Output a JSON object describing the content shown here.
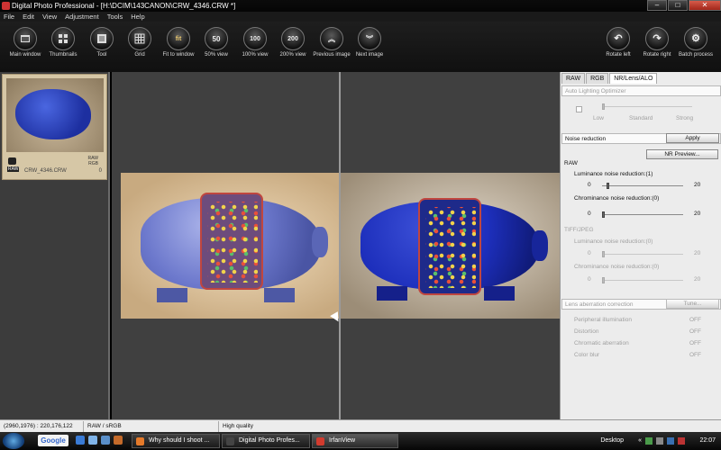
{
  "window": {
    "title": "Digital Photo Professional - [H:\\DCIM\\143CANON\\CRW_4346.CRW *]",
    "minimize_label": "–",
    "maximize_label": "□",
    "close_label": "✕"
  },
  "menu": [
    "File",
    "Edit",
    "View",
    "Adjustment",
    "Tools",
    "Help"
  ],
  "toolbar": {
    "buttons": [
      {
        "label": "Main window",
        "glyph": ""
      },
      {
        "label": "Thumbnails",
        "glyph": ""
      },
      {
        "label": "Tool",
        "glyph": ""
      },
      {
        "label": "Grid",
        "glyph": ""
      },
      {
        "label": "Fit to window",
        "glyph": "fit"
      },
      {
        "label": "50% view",
        "glyph": "50"
      },
      {
        "label": "100% view",
        "glyph": "100"
      },
      {
        "label": "200% view",
        "glyph": "200"
      },
      {
        "label": "Previous image",
        "glyph": "︽"
      },
      {
        "label": "Next image",
        "glyph": "︾"
      }
    ],
    "right_buttons": [
      {
        "label": "Rotate left",
        "glyph": "↶"
      },
      {
        "label": "Rotate right",
        "glyph": "↷"
      },
      {
        "label": "Batch process",
        "glyph": "⚙"
      }
    ]
  },
  "thumbnail": {
    "filename": "CRW_4346.CRW",
    "tags": [
      "RAW",
      "RGB"
    ],
    "raw_badge": "RAW",
    "index": "0"
  },
  "palette": {
    "tabs": [
      "RAW",
      "RGB",
      "NR/Lens/ALO"
    ],
    "active_tab": "NR/Lens/ALO",
    "alo": {
      "title": "Auto Lighting Optimizer",
      "levels": [
        "Low",
        "Standard",
        "Strong"
      ],
      "enabled": false
    },
    "nr": {
      "title": "Noise reduction",
      "apply_label": "Apply",
      "preview_label": "NR Preview...",
      "raw_heading": "RAW",
      "raw_luminance_label": "Luminance noise reduction:(1)",
      "raw_luminance_value": 1,
      "raw_chrominance_label": "Chrominance noise reduction:(0)",
      "raw_chrominance_value": 0,
      "slider_min": "0",
      "slider_max": "20",
      "tiff_heading": "TIFF/JPEG",
      "tiff_luminance_label": "Luminance noise reduction:(0)",
      "tiff_chrominance_label": "Chrominance noise reduction:(0)"
    },
    "lens": {
      "title": "Lens aberration correction",
      "tune_label": "Tune...",
      "items": [
        {
          "label": "Peripheral illumination",
          "value": "OFF"
        },
        {
          "label": "Distortion",
          "value": "OFF"
        },
        {
          "label": "Chromatic aberration",
          "value": "OFF"
        },
        {
          "label": "Color blur",
          "value": "OFF"
        }
      ]
    }
  },
  "status": {
    "coords": "(2960,1976) : 220,176,122",
    "mode": "RAW / sRGB",
    "quality": "High quality"
  },
  "taskbar": {
    "search": "Google",
    "tasks": [
      {
        "label": "Why should I shoot ...",
        "active": false
      },
      {
        "label": "Digital Photo Profes...",
        "active": false
      },
      {
        "label": "IrfanView",
        "active": true
      }
    ],
    "desktop_label": "Desktop",
    "tray_arrows": "« ◂",
    "clock": "22:07"
  }
}
